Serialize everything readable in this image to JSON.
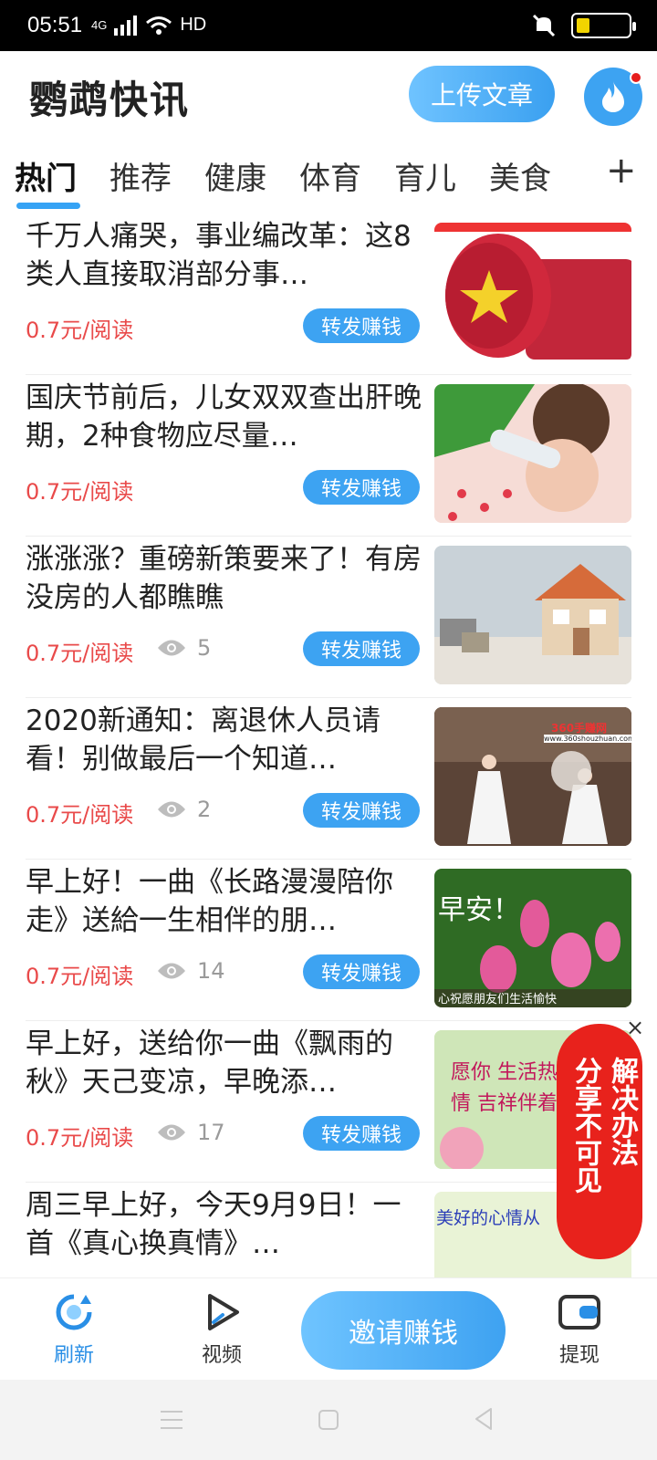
{
  "status_bar": {
    "time": "05:51",
    "network": "4G",
    "hd": "HD"
  },
  "header": {
    "title": "鹦鹉快讯",
    "upload_label": "上传文章"
  },
  "tabs": [
    "热门",
    "推荐",
    "健康",
    "体育",
    "育儿",
    "美食"
  ],
  "tab_add": "+",
  "feed": [
    {
      "title": "千万人痛哭，事业编改革：这8类人直接取消部分事…",
      "price": "0.7元/阅读",
      "views": "",
      "share": "转发赚钱",
      "thumb": "stamp"
    },
    {
      "title": "国庆节前后，儿女双双查出肝晚期，2种食物应尽量…",
      "price": "0.7元/阅读",
      "views": "",
      "share": "转发赚钱",
      "thumb": "kids"
    },
    {
      "title": "涨涨涨？重磅新策要来了！有房没房的人都瞧瞧",
      "price": "0.7元/阅读",
      "views": "5",
      "share": "转发赚钱",
      "thumb": "house"
    },
    {
      "title": "2020新通知：离退休人员请看！别做最后一个知道…",
      "price": "0.7元/阅读",
      "views": "2",
      "share": "转发赚钱",
      "thumb": "dance",
      "thumb_text": "360手赚网",
      "thumb_url": "www.360shouzhuan.com"
    },
    {
      "title": "早上好！一曲《长路漫漫陪你走》送給一生相伴的朋…",
      "price": "0.7元/阅读",
      "views": "14",
      "share": "转发赚钱",
      "thumb": "flowers",
      "thumb_text": "早安！",
      "thumb_caption": "心祝愿朋友们生活愉快"
    },
    {
      "title": "早上好，送给你一曲《飘雨的秋》天己变凉，早晚添…",
      "price": "0.7元/阅读",
      "views": "17",
      "share": "转发赚钱",
      "thumb": "greeting",
      "thumb_text": "愿你 生活热情 吉祥伴着"
    },
    {
      "title": "周三早上好，今天9月9日！一首《真心换真情》…",
      "price": "",
      "views": "",
      "share": "",
      "thumb": "mood",
      "thumb_text": "美好的心情从"
    }
  ],
  "float_banner": {
    "col1": "分享不可见",
    "col2": "解决办法",
    "close": "×"
  },
  "bottom_nav": {
    "refresh": "刷新",
    "video": "视频",
    "invite": "邀请赚钱",
    "withdraw": "提现"
  },
  "colors": {
    "accent": "#3da3f2",
    "price": "#e94a4a",
    "banner": "#e8221c"
  }
}
